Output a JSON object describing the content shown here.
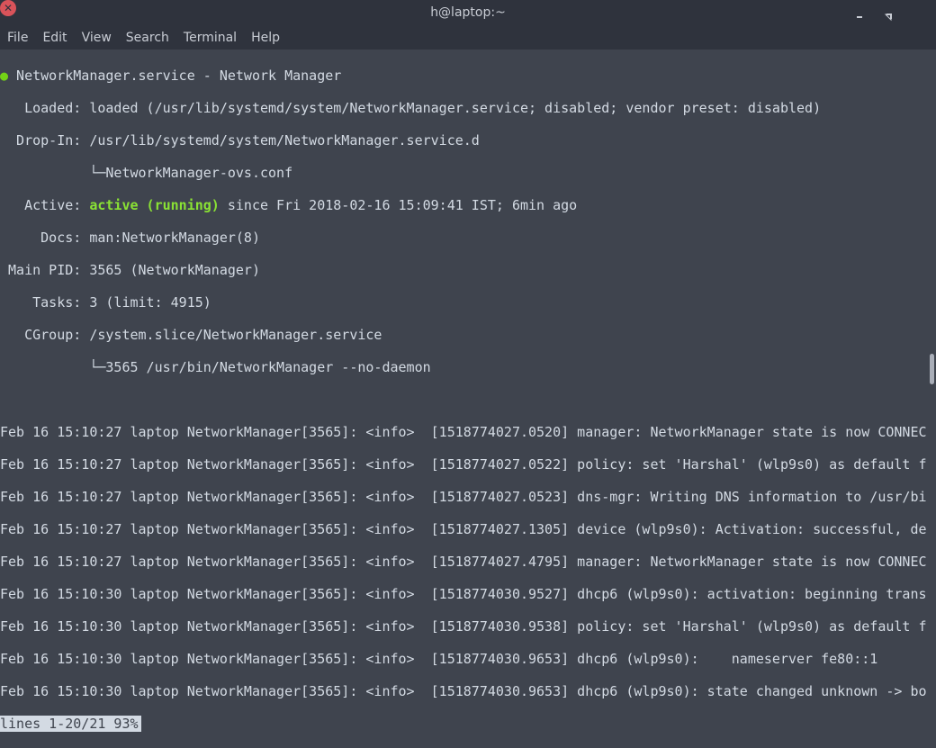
{
  "window": {
    "title": "h@laptop:~",
    "close_glyph": "✕"
  },
  "menu": [
    "File",
    "Edit",
    "View",
    "Search",
    "Terminal",
    "Help"
  ],
  "status": {
    "dot": "●",
    "header": " NetworkManager.service - Network Manager",
    "loaded": "   Loaded: loaded (/usr/lib/systemd/system/NetworkManager.service; disabled; vendor preset: disabled)",
    "dropin": "  Drop-In: /usr/lib/systemd/system/NetworkManager.service.d",
    "dropin_file": "           └─NetworkManager-ovs.conf",
    "active_label": "   Active: ",
    "active_state": "active (running)",
    "active_since": " since Fri 2018-02-16 15:09:41 IST; 6min ago",
    "docs": "     Docs: man:NetworkManager(8)",
    "pid": " Main PID: 3565 (NetworkManager)",
    "tasks": "    Tasks: 3 (limit: 4915)",
    "cgroup": "   CGroup: /system.slice/NetworkManager.service",
    "cgroup_proc": "           └─3565 /usr/bin/NetworkManager --no-daemon"
  },
  "log": [
    "Feb 16 15:10:27 laptop NetworkManager[3565]: <info>  [1518774027.0520] manager: NetworkManager state is now CONNEC",
    "Feb 16 15:10:27 laptop NetworkManager[3565]: <info>  [1518774027.0522] policy: set 'Harshal' (wlp9s0) as default f",
    "Feb 16 15:10:27 laptop NetworkManager[3565]: <info>  [1518774027.0523] dns-mgr: Writing DNS information to /usr/bi",
    "Feb 16 15:10:27 laptop NetworkManager[3565]: <info>  [1518774027.1305] device (wlp9s0): Activation: successful, de",
    "Feb 16 15:10:27 laptop NetworkManager[3565]: <info>  [1518774027.4795] manager: NetworkManager state is now CONNEC",
    "Feb 16 15:10:30 laptop NetworkManager[3565]: <info>  [1518774030.9527] dhcp6 (wlp9s0): activation: beginning trans",
    "Feb 16 15:10:30 laptop NetworkManager[3565]: <info>  [1518774030.9538] policy: set 'Harshal' (wlp9s0) as default f",
    "Feb 16 15:10:30 laptop NetworkManager[3565]: <info>  [1518774030.9653] dhcp6 (wlp9s0):    nameserver fe80::1",
    "Feb 16 15:10:30 laptop NetworkManager[3565]: <info>  [1518774030.9653] dhcp6 (wlp9s0): state changed unknown -> bo"
  ],
  "pager": "lines 1-20/21 93%"
}
